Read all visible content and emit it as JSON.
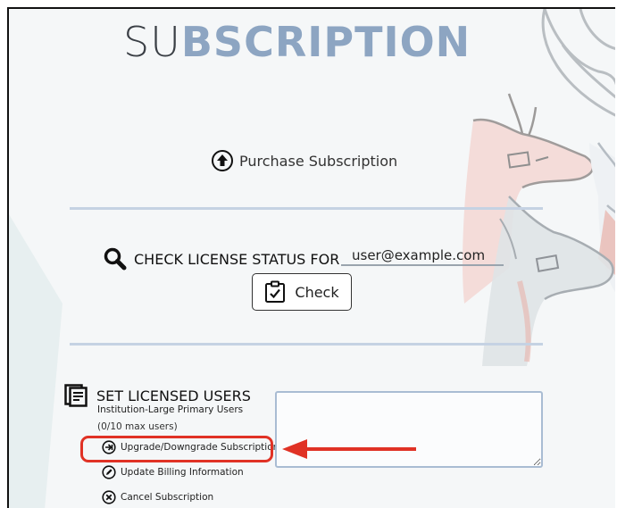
{
  "page": {
    "title_light": "SU",
    "title_bold": "BSCRIPTION"
  },
  "purchase": {
    "label": "Purchase Subscription",
    "icon": "up-arrow-circle-icon"
  },
  "license_check": {
    "label": "CHECK LICENSE STATUS FOR",
    "email_value": "user@example.com",
    "button_label": "Check",
    "search_icon": "magnifier-icon",
    "button_icon": "clipboard-check-icon"
  },
  "licensed_users": {
    "title": "SET LICENSED USERS",
    "tier": "Institution-Large Primary Users",
    "count": "(0/10 max users)",
    "textarea_value": "",
    "links": [
      {
        "label": "Upgrade/Downgrade Subscription",
        "icon": "arrow-right-circle-icon"
      },
      {
        "label": "Update Billing Information",
        "icon": "pencil-circle-icon"
      },
      {
        "label": "Cancel Subscription",
        "icon": "x-circle-icon"
      }
    ]
  },
  "annotation": {
    "highlight_color": "#e03225"
  },
  "colors": {
    "title_accent": "#8da5c2",
    "divider": "#c5d2e3",
    "background": "#f5f7f8"
  }
}
